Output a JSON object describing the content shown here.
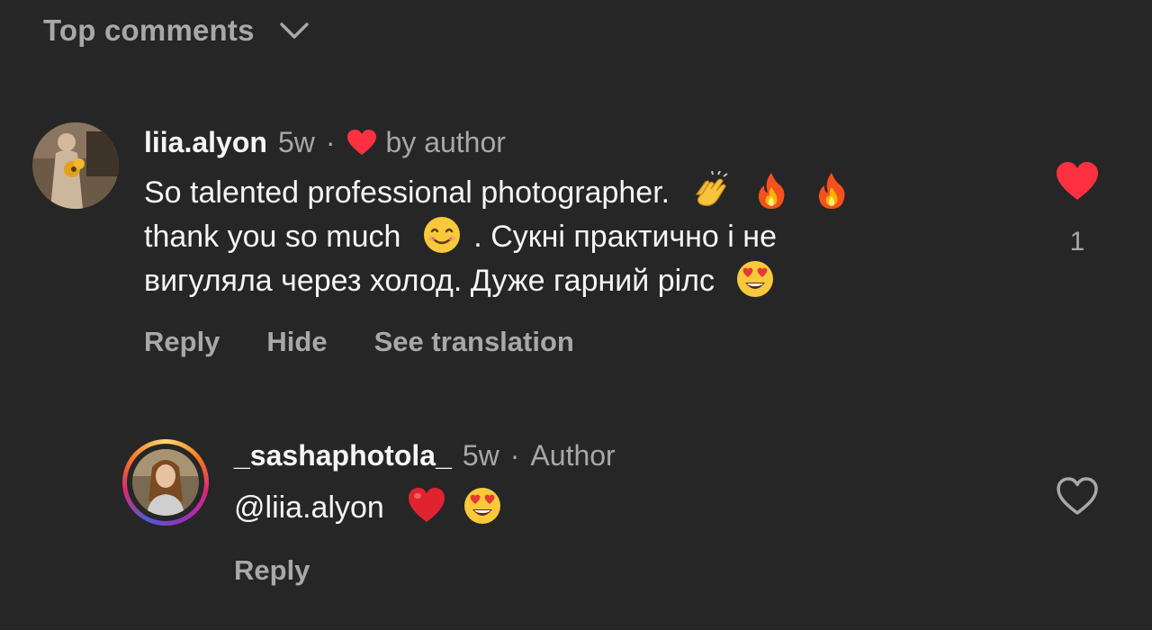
{
  "header": {
    "sort_label": "Top comments"
  },
  "comments": [
    {
      "username": "liia.alyon",
      "age": "5w",
      "separator": "·",
      "author_like_label": "by author",
      "body_line1": "So talented professional photographer.",
      "body_line2_a": "thank you so much",
      "body_line2_b": ". Сукні практично і не",
      "body_line3": "вигуляла через холод. Дуже гарний рілс",
      "actions": {
        "reply": "Reply",
        "hide": "Hide",
        "translate": "See translation"
      },
      "like_count": "1",
      "liked": true
    },
    {
      "username": "_sashaphotola_",
      "age": "5w",
      "separator": "·",
      "author_badge": "Author",
      "body": "@liia.alyon",
      "actions": {
        "reply": "Reply"
      },
      "liked": false
    }
  ],
  "colors": {
    "background": "#262626",
    "primary_text": "#f5f5f5",
    "secondary_text": "#a8a8a8",
    "like_red": "#ff3040"
  },
  "icons": [
    "chevron-down-icon",
    "heart-filled-icon",
    "heart-outline-icon",
    "clapping-hands-emoji",
    "fire-emoji",
    "smiling-face-emoji",
    "heart-eyes-emoji",
    "red-heart-emoji"
  ]
}
